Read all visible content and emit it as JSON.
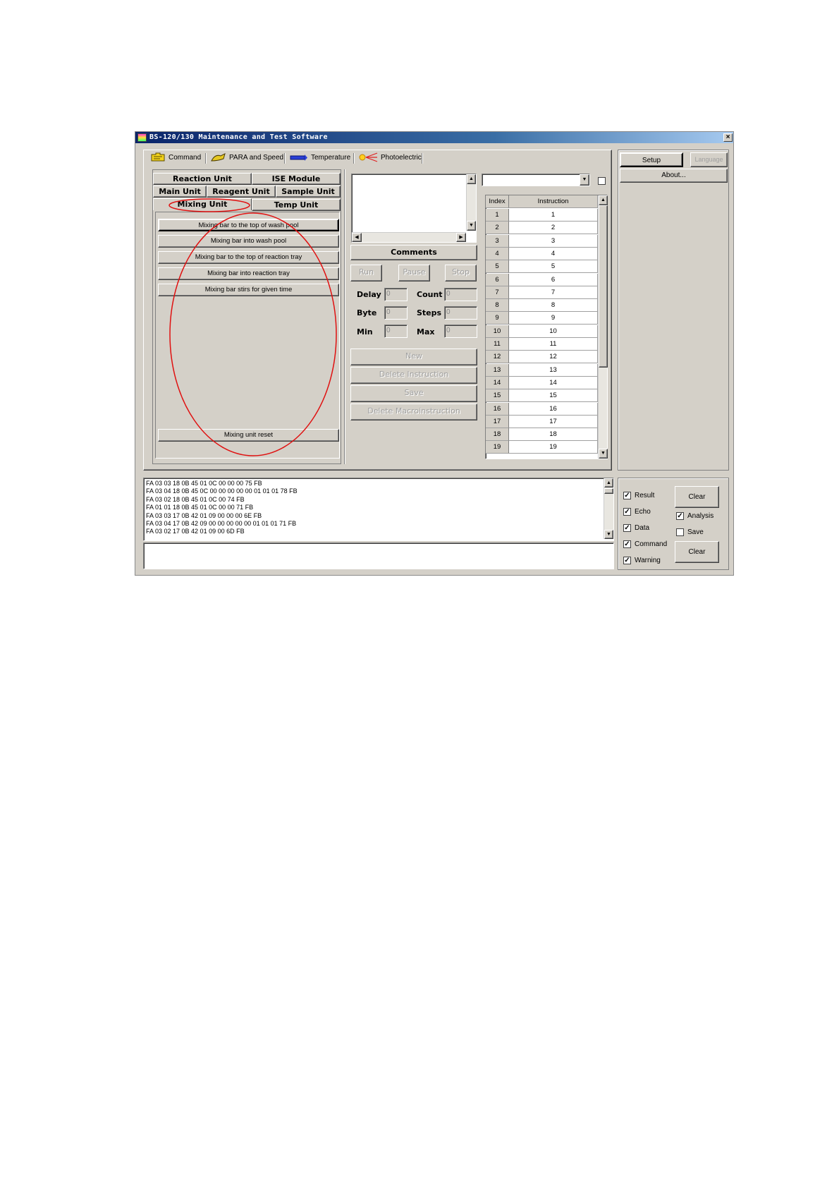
{
  "window": {
    "title": "BS-120/130 Maintenance and Test Software",
    "close": "×"
  },
  "top_tabs": [
    {
      "label": "Command",
      "icon": "command-icon"
    },
    {
      "label": "PARA and Speed",
      "icon": "para-speed-icon"
    },
    {
      "label": "Temperature",
      "icon": "temperature-icon"
    },
    {
      "label": "Photoelectric",
      "icon": "photoelectric-icon"
    }
  ],
  "unit_tabs": {
    "row1": [
      "Reaction Unit",
      "ISE Module"
    ],
    "row2": [
      "Main Unit",
      "Reagent Unit",
      "Sample Unit"
    ],
    "row3": [
      "Mixing Unit",
      "Temp Unit"
    ],
    "selected": "Mixing Unit"
  },
  "mixing_commands": [
    "Mixing bar to the top of wash pool",
    "Mixing bar into wash pool",
    "Mixing bar to the top of reaction tray",
    "Mixing bar into reaction tray",
    "Mixing bar stirs for given time"
  ],
  "reset_button": "Mixing unit reset",
  "comments_label": "Comments",
  "run_controls": {
    "run": "Run",
    "pause": "Pause",
    "stop": "Stop"
  },
  "params": {
    "delay_label": "Delay",
    "delay_value": "0",
    "count_label": "Count",
    "count_value": "0",
    "byte_label": "Byte",
    "byte_value": "0",
    "steps_label": "Steps",
    "steps_value": "0",
    "min_label": "Min",
    "min_value": "0",
    "max_label": "Max",
    "max_value": "0"
  },
  "macro_buttons": {
    "new": "New",
    "delete_instruction": "Delete Instruction",
    "save": "Save",
    "delete_macro": "Delete Macroinstruction"
  },
  "grid": {
    "headers": [
      "Index",
      "Instruction"
    ],
    "rows": [
      [
        "1",
        "1"
      ],
      [
        "2",
        "2"
      ],
      [
        "3",
        "3"
      ],
      [
        "4",
        "4"
      ],
      [
        "5",
        "5"
      ],
      [
        "6",
        "6"
      ],
      [
        "7",
        "7"
      ],
      [
        "8",
        "8"
      ],
      [
        "9",
        "9"
      ],
      [
        "10",
        "10"
      ],
      [
        "11",
        "11"
      ],
      [
        "12",
        "12"
      ],
      [
        "13",
        "13"
      ],
      [
        "14",
        "14"
      ],
      [
        "15",
        "15"
      ],
      [
        "16",
        "16"
      ],
      [
        "17",
        "17"
      ],
      [
        "18",
        "18"
      ],
      [
        "19",
        "19"
      ]
    ]
  },
  "right_panel": {
    "setup": "Setup",
    "language": "Language",
    "about": "About..."
  },
  "log_lines": [
    "FA 03 03 18 0B 45 01 0C 00 00 00 75 FB",
    "FA 03 04 18 0B 45 0C 00 00 00 00 00 01 01 01 78 FB",
    "FA 03 02 18 0B 45 01 0C 00 74 FB",
    "FA 01 01 18 0B 45 01 0C 00 00 71 FB",
    "FA 03 03 17 0B 42 01 09 00 00 00 6E FB",
    "FA 03 04 17 0B 42 09 00 00 00 00 00 01 01 01 71 FB",
    "FA 03 02 17 0B 42 01 09 00 6D FB"
  ],
  "log_options": {
    "result": {
      "label": "Result",
      "checked": true
    },
    "echo": {
      "label": "Echo",
      "checked": true
    },
    "data": {
      "label": "Data",
      "checked": true
    },
    "command": {
      "label": "Command",
      "checked": true
    },
    "warning": {
      "label": "Warning",
      "checked": true
    },
    "analysis": {
      "label": "Analysis",
      "checked": true
    },
    "save": {
      "label": "Save",
      "checked": false
    },
    "clear1": "Clear",
    "clear2": "Clear"
  },
  "check_mark": "✓"
}
